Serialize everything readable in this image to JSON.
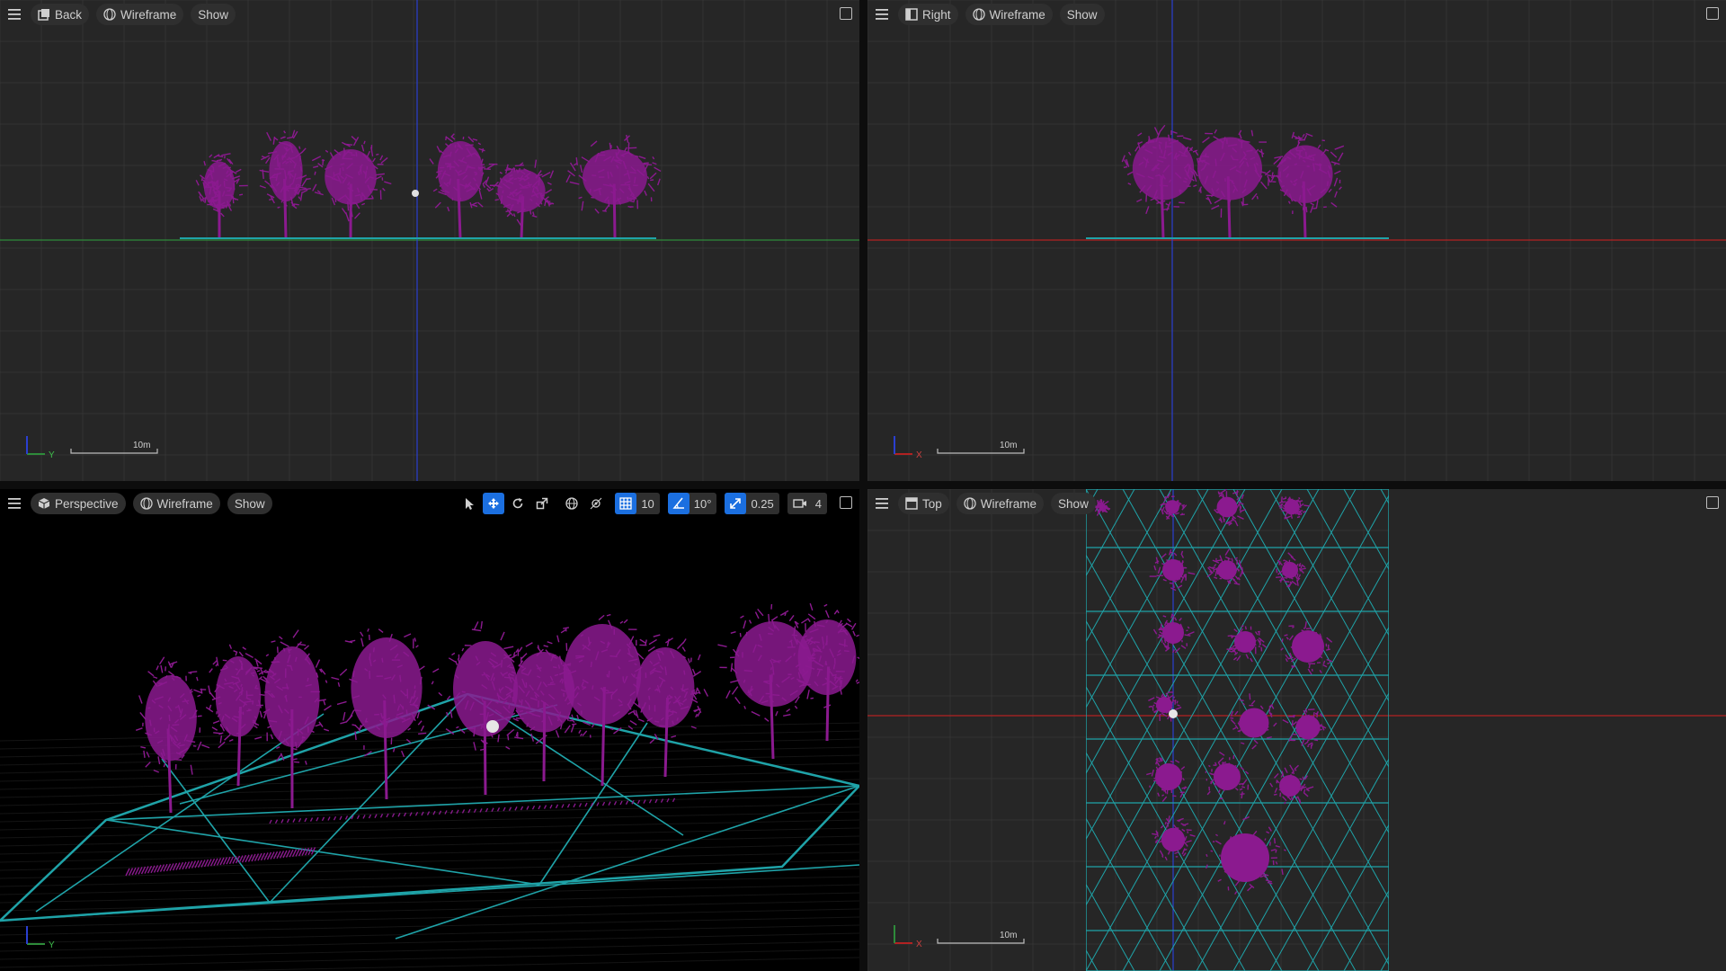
{
  "viewports": {
    "back": {
      "view_label": "Back",
      "view_icon": "front-view-icon",
      "mode_label": "Wireframe",
      "show_label": "Show",
      "scale_label": "10m",
      "axis_label": "Y"
    },
    "right": {
      "view_label": "Right",
      "view_icon": "side-view-icon",
      "mode_label": "Wireframe",
      "show_label": "Show",
      "scale_label": "10m",
      "axis_label": "X"
    },
    "perspective": {
      "view_label": "Perspective",
      "view_icon": "perspective-cube-icon",
      "mode_label": "Wireframe",
      "show_label": "Show",
      "grid_snap_value": "10",
      "rotation_snap_value": "10°",
      "scale_snap_value": "0.25",
      "camera_speed_value": "4",
      "axis_label": "Y"
    },
    "top": {
      "view_label": "Top",
      "view_icon": "top-view-icon",
      "mode_label": "Wireframe",
      "show_label": "Show",
      "scale_label": "10m",
      "axis_label": "X"
    }
  },
  "colors": {
    "foliage": "#8b1a8f",
    "ground_wire": "#1fa3a8",
    "grid": "#333333",
    "axis_red": "#b22222",
    "axis_green": "#2e8b3a",
    "axis_blue": "#2a3fd0",
    "accent": "#1b6fe0"
  },
  "tools": [
    "select-arrow-icon",
    "translate-icon",
    "rotate-icon",
    "scale-icon",
    "world-space-icon",
    "surface-snap-icon"
  ]
}
